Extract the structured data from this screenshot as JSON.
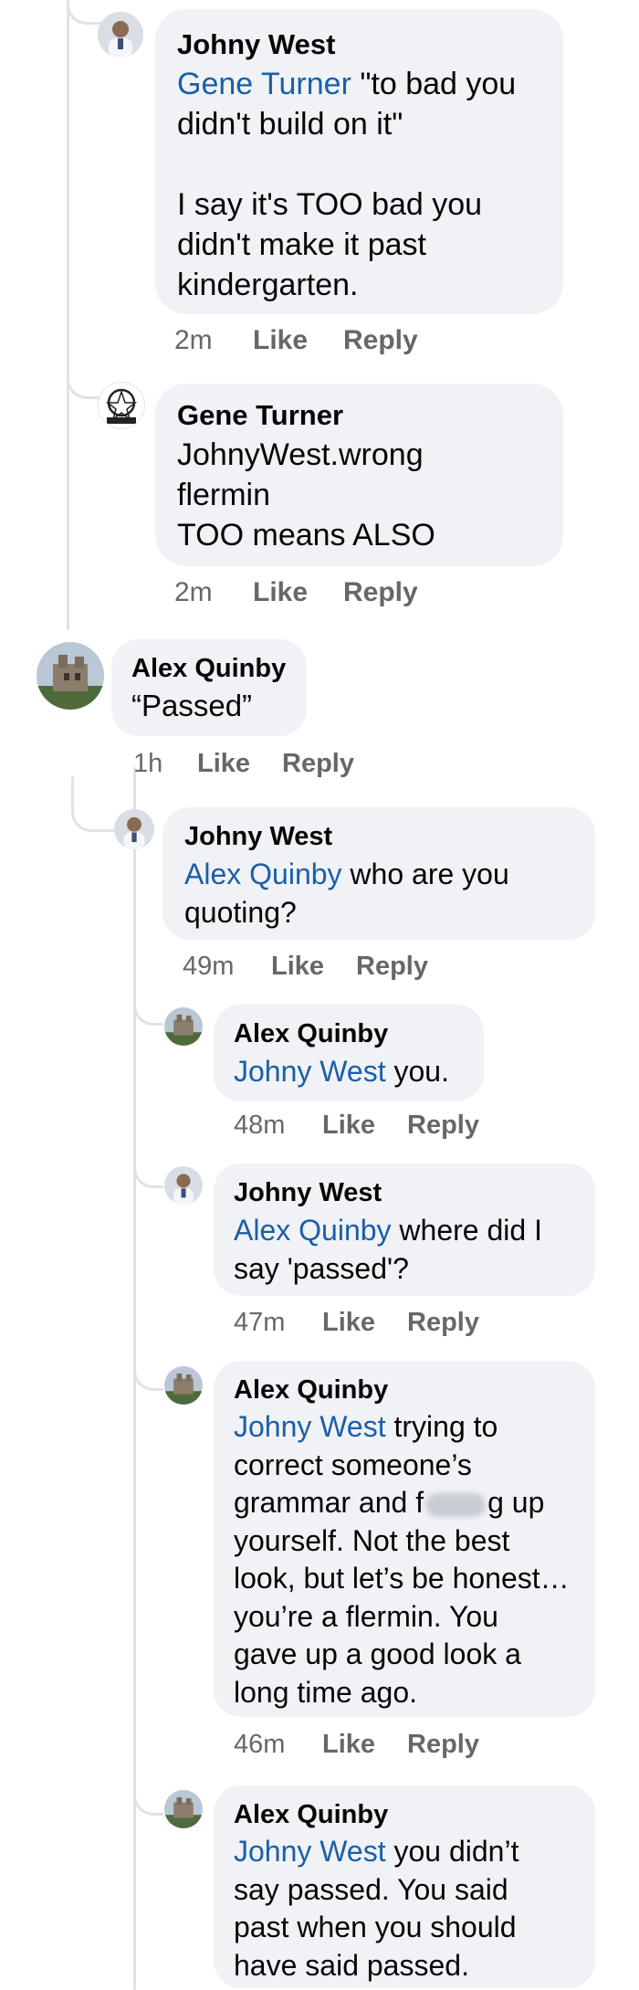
{
  "comments": [
    {
      "author": "Johny West",
      "mention": "Gene Turner",
      "lines": [
        " \"to bad you",
        "didn't build on it\"",
        "",
        "I say it's TOO bad you",
        "didn't make it past",
        "kindergarten."
      ],
      "time": "2m",
      "like": "Like",
      "reply": "Reply"
    },
    {
      "author": "Gene Turner",
      "lines": [
        "JohnyWest.wrong",
        "flermin",
        "TOO means ALSO"
      ],
      "time": "2m",
      "like": "Like",
      "reply": "Reply"
    },
    {
      "author": "Alex Quinby",
      "lines": [
        "“Passed”"
      ],
      "time": "1h",
      "like": "Like",
      "reply": "Reply"
    },
    {
      "author": "Johny West",
      "mention": "Alex Quinby",
      "lines": [
        " who are you",
        "quoting?"
      ],
      "time": "49m",
      "like": "Like",
      "reply": "Reply"
    },
    {
      "author": "Alex Quinby",
      "mention": "Johny West",
      "lines": [
        " you."
      ],
      "time": "48m",
      "like": "Like",
      "reply": "Reply"
    },
    {
      "author": "Johny West",
      "mention": "Alex Quinby",
      "lines": [
        " where did I",
        "say 'passed'?"
      ],
      "time": "47m",
      "like": "Like",
      "reply": "Reply"
    },
    {
      "author": "Alex Quinby",
      "mention": "Johny West",
      "lines": [
        " trying to",
        "correct someone’s",
        "grammar and f",
        "g up",
        "yourself. Not the best",
        "look, but let’s be honest…",
        "you’re a flermin. You",
        "gave up a good look a",
        "long time ago."
      ],
      "time": "46m",
      "like": "Like",
      "reply": "Reply"
    },
    {
      "author": "Alex Quinby",
      "mention": "Johny West",
      "lines": [
        " you didn’t",
        "say passed. You said",
        "past when you should",
        "have said passed."
      ]
    }
  ],
  "colors": {
    "mention": "#1a5fa8",
    "bubble": "#f0f2f5",
    "meta": "#65676b"
  }
}
